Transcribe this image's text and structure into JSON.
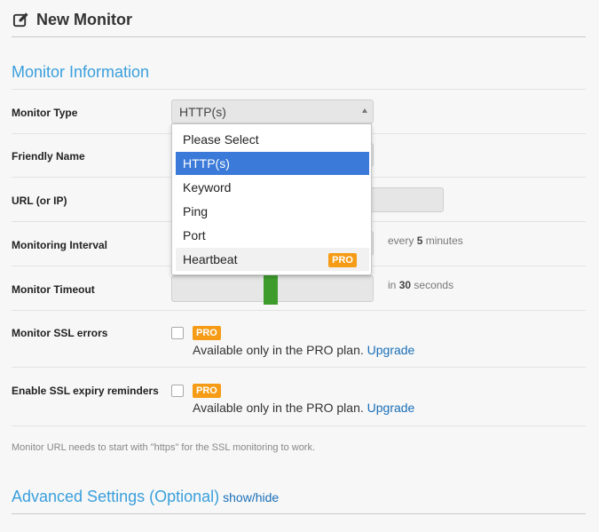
{
  "header": {
    "title": "New Monitor",
    "icon": "edit-icon"
  },
  "sections": {
    "monitor_information": "Monitor Information",
    "advanced": {
      "title": "Advanced Settings (Optional)",
      "toggle": "show/hide"
    }
  },
  "fields": {
    "monitor_type": {
      "label": "Monitor Type",
      "value": "HTTP(s)"
    },
    "friendly_name": {
      "label": "Friendly Name"
    },
    "url": {
      "label": "URL (or IP)"
    },
    "interval": {
      "label": "Monitoring Interval",
      "hint_prefix": "every",
      "hint_value": "5",
      "hint_suffix": "minutes"
    },
    "timeout": {
      "label": "Monitor Timeout",
      "hint_prefix": "in",
      "hint_value": "30",
      "hint_suffix": "seconds"
    },
    "ssl_errors": {
      "label": "Monitor SSL errors",
      "pro": "PRO",
      "availability": "Available only in the PRO plan.",
      "upgrade": "Upgrade"
    },
    "ssl_expiry": {
      "label": "Enable SSL expiry reminders",
      "pro": "PRO",
      "availability": "Available only in the PRO plan.",
      "upgrade": "Upgrade"
    }
  },
  "dropdown": {
    "options": [
      {
        "label": "Please Select"
      },
      {
        "label": "HTTP(s)",
        "selected": true
      },
      {
        "label": "Keyword"
      },
      {
        "label": "Ping"
      },
      {
        "label": "Port"
      },
      {
        "label": "Heartbeat",
        "badge": "PRO",
        "hovered": true
      }
    ]
  },
  "note": "Monitor URL needs to start with \"https\" for the SSL monitoring to work.",
  "colors": {
    "accent": "#3a9fdc",
    "selected": "#3b7ad8",
    "pro_badge": "#f59b16",
    "slider": "#3e9c2d",
    "link": "#1a6fb8"
  }
}
